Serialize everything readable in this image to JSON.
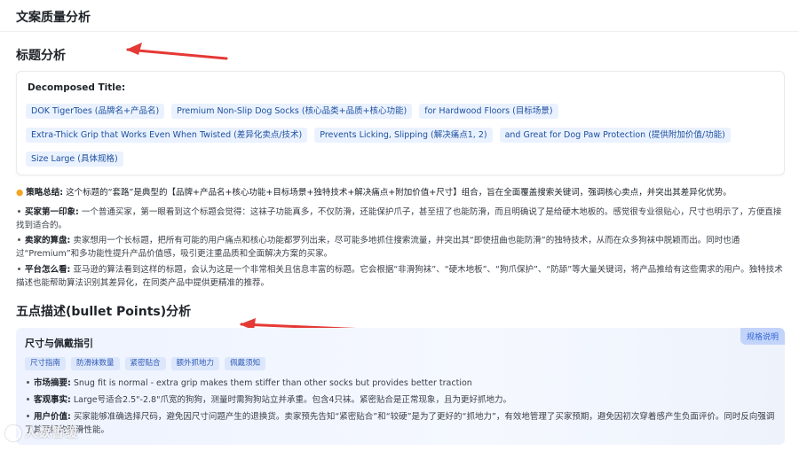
{
  "header": {
    "title": "文案质量分析"
  },
  "title_analysis": {
    "heading": "标题分析",
    "decomposed_label": "Decomposed Title:",
    "chips_row1": [
      "DOK TigerToes (品牌名+产品名)",
      "Premium Non-Slip Dog Socks (核心品类+品质+核心功能)",
      "for Hardwood Floors (目标场景)"
    ],
    "chips_row2": [
      "Extra-Thick Grip that Works Even When Twisted (差异化卖点/技术)",
      "Prevents Licking, Slipping (解决痛点1, 2)",
      "and Great for Dog Paw Protection (提供附加价值/功能)"
    ],
    "chips_row3": [
      "Size Large (具体规格)"
    ],
    "summary_label": "策略总结:",
    "summary_text": "这个标题的“套路”是典型的【品牌+产品名+核心功能+目标场景+独特技术+解决痛点+附加价值+尺寸】组合，旨在全面覆盖搜索关键词，强调核心卖点，并突出其差异化优势。",
    "bullets": [
      {
        "label": "买家第一印象:",
        "text": "一个普通买家，第一眼看到这个标题会觉得：这袜子功能真多，不仅防滑，还能保护爪子，甚至扭了也能防滑，而且明确说了是给硬木地板的。感觉很专业很贴心，尺寸也明示了，方便直接找到适合的。"
      },
      {
        "label": "卖家的算盘:",
        "text": "卖家想用一个长标题，把所有可能的用户痛点和核心功能都罗列出来，尽可能多地抓住搜索流量，并突出其“即使扭曲也能防滑”的独特技术，从而在众多狗袜中脱颖而出。同时也通过“Premium”和多功能性提升产品价值感，吸引更注重品质和全面解决方案的买家。"
      },
      {
        "label": "平台怎么看:",
        "text": "亚马逊的算法看到这样的标题，会认为这是一个非常相关且信息丰富的标题。它会根据“非滑狗袜”、“硬木地板”、“狗爪保护”、“防舔”等大量关键词，将产品推给有这些需求的用户。独特技术描述也能帮助算法识别其差异化，在同类产品中提供更精准的推荐。"
      }
    ]
  },
  "bullet_points": {
    "heading": "五点描述(bullet Points)分析",
    "card_title": "尺寸与佩戴指引",
    "badge": "规格说明",
    "tags": [
      "尺寸指南",
      "防滑袜数量",
      "紧密贴合",
      "额外抓地力",
      "佩戴须知"
    ],
    "lines": [
      {
        "label": "市场摘要:",
        "text": "Snug fit is normal - extra grip makes them stiffer than other socks but provides better traction"
      },
      {
        "label": "客观事实:",
        "text": "Large号适合2.5\"-2.8\"爪宽的狗狗，测量时需狗狗站立并承重。包含4只袜。紧密贴合是正常现象，且为更好抓地力。"
      },
      {
        "label": "用户价值:",
        "text": "买家能够准确选择尺码，避免因尺寸问题产生的退换货。卖家预先告知“紧密贴合”和“较硬”是为了更好的“抓地力”，有效地管理了买家预期，避免因初次穿着感产生负面评价。同时反向强调了其更好的防滑性能。"
      }
    ]
  },
  "watermark": {
    "text": "人数暂缓"
  },
  "colors": {
    "arrow": "#e53935",
    "chip_bg": "#eaf2ff",
    "chip_text": "#1d4f9e"
  }
}
